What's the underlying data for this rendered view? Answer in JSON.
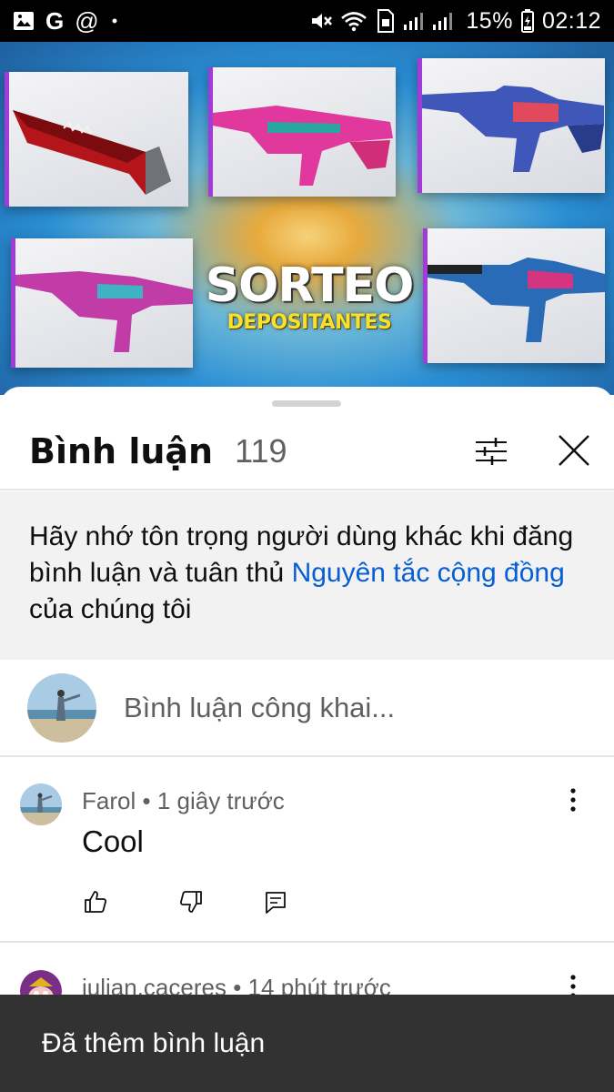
{
  "status_bar": {
    "battery": "15%",
    "time": "02:12",
    "icons": [
      "gallery-icon",
      "google-icon",
      "at-icon",
      "dot-icon",
      "mute-icon",
      "wifi-icon",
      "sim-icon",
      "signal-icon",
      "battery-icon"
    ]
  },
  "video": {
    "title_main": "SORTEO",
    "title_sub": "DEPOSITANTES"
  },
  "comments_panel": {
    "title": "Bình luận",
    "count": "119",
    "notice_prefix": "Hãy nhớ tôn trọng người dùng khác khi đăng bình luận và tuân thủ ",
    "notice_link": "Nguyên tắc cộng đồng",
    "notice_suffix": " của chúng tôi",
    "input_placeholder": "Bình luận công khai..."
  },
  "comments": [
    {
      "author": "Farol",
      "time": "1 giây trước",
      "text": "Cool"
    },
    {
      "author": "julian.caceres",
      "time": "14 phút trước",
      "text": ""
    }
  ],
  "snackbar": {
    "message": "Đã thêm bình luận"
  },
  "colors": {
    "link": "#065fd4",
    "snackbar_bg": "#323232",
    "notice_bg": "#f2f2f2",
    "secondary_text": "#606060"
  }
}
